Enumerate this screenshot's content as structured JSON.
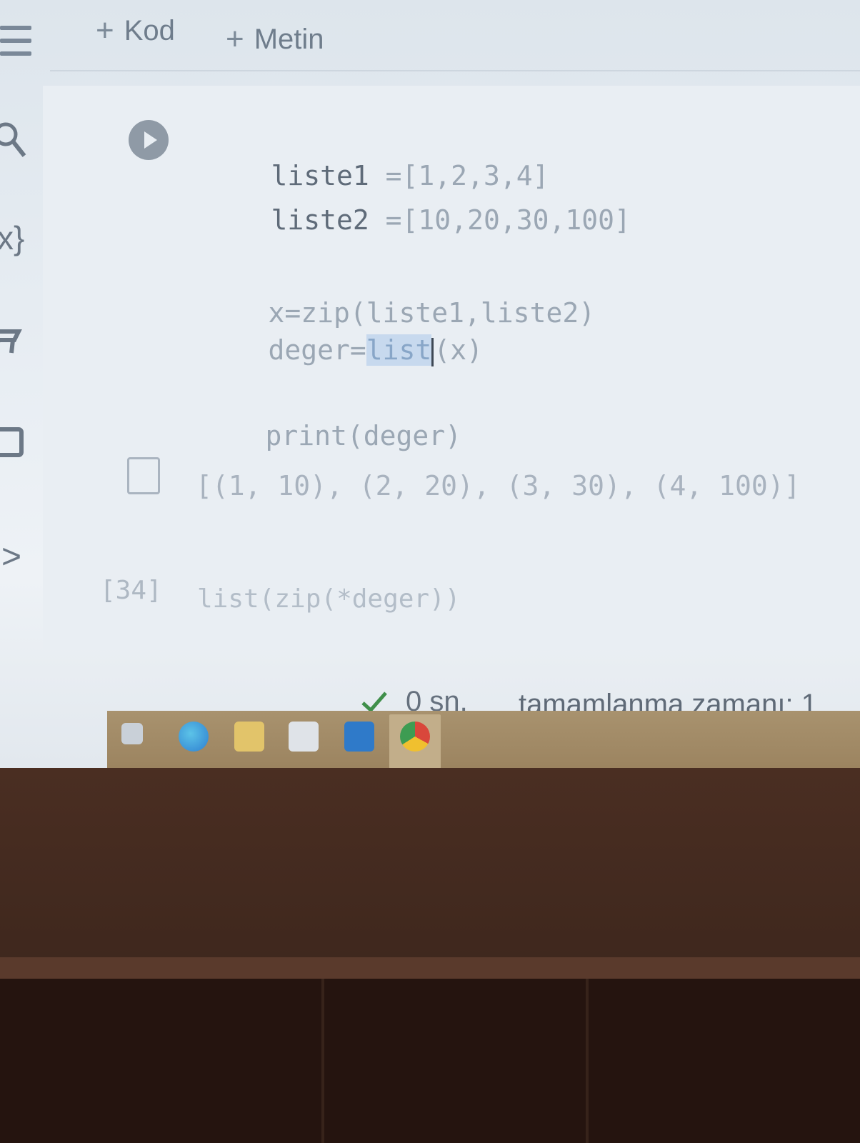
{
  "toolbar": {
    "menu_icon": "hamburger-menu-icon",
    "add_code_plus": "+",
    "add_code_label": "Kod",
    "add_text_plus": "+",
    "add_text_label": "Metin"
  },
  "sidebar": {
    "icons": [
      "search-icon",
      "variables-icon",
      "files-icon",
      "panel-icon",
      "expand-icon"
    ],
    "variables_glyph": "x}",
    "expand_glyph": ">"
  },
  "cell": {
    "lines": {
      "l1_name": "liste1",
      "l1_rest": " =[1,2,3,4]",
      "l2_name": "liste2",
      "l2_rest": " =[10,20,30,100]",
      "l3": "x=zip(liste1,liste2)",
      "l4_a": "deger=",
      "l4_b": "list",
      "l4_c": "(x)",
      "l5": "print(deger)"
    },
    "output": "[(1, 10), (2, 20), (3, 30), (4, 100)]"
  },
  "next_cell": {
    "exec_count": "[34]",
    "code": "list(zip(*deger))"
  },
  "status": {
    "duration": "0 sn.",
    "completion_label": "tamamlanma zamanı: 1"
  },
  "taskbar": {
    "icons": [
      "task-view-icon",
      "edge-icon",
      "file-explorer-icon",
      "store-icon",
      "mail-icon",
      "chrome-icon"
    ]
  },
  "colors": {
    "screen_bg": "#e6ecf2",
    "taskbar": "#a8926e",
    "check_green": "#3f8f4a",
    "edge_blue": "#2e7fd0"
  }
}
